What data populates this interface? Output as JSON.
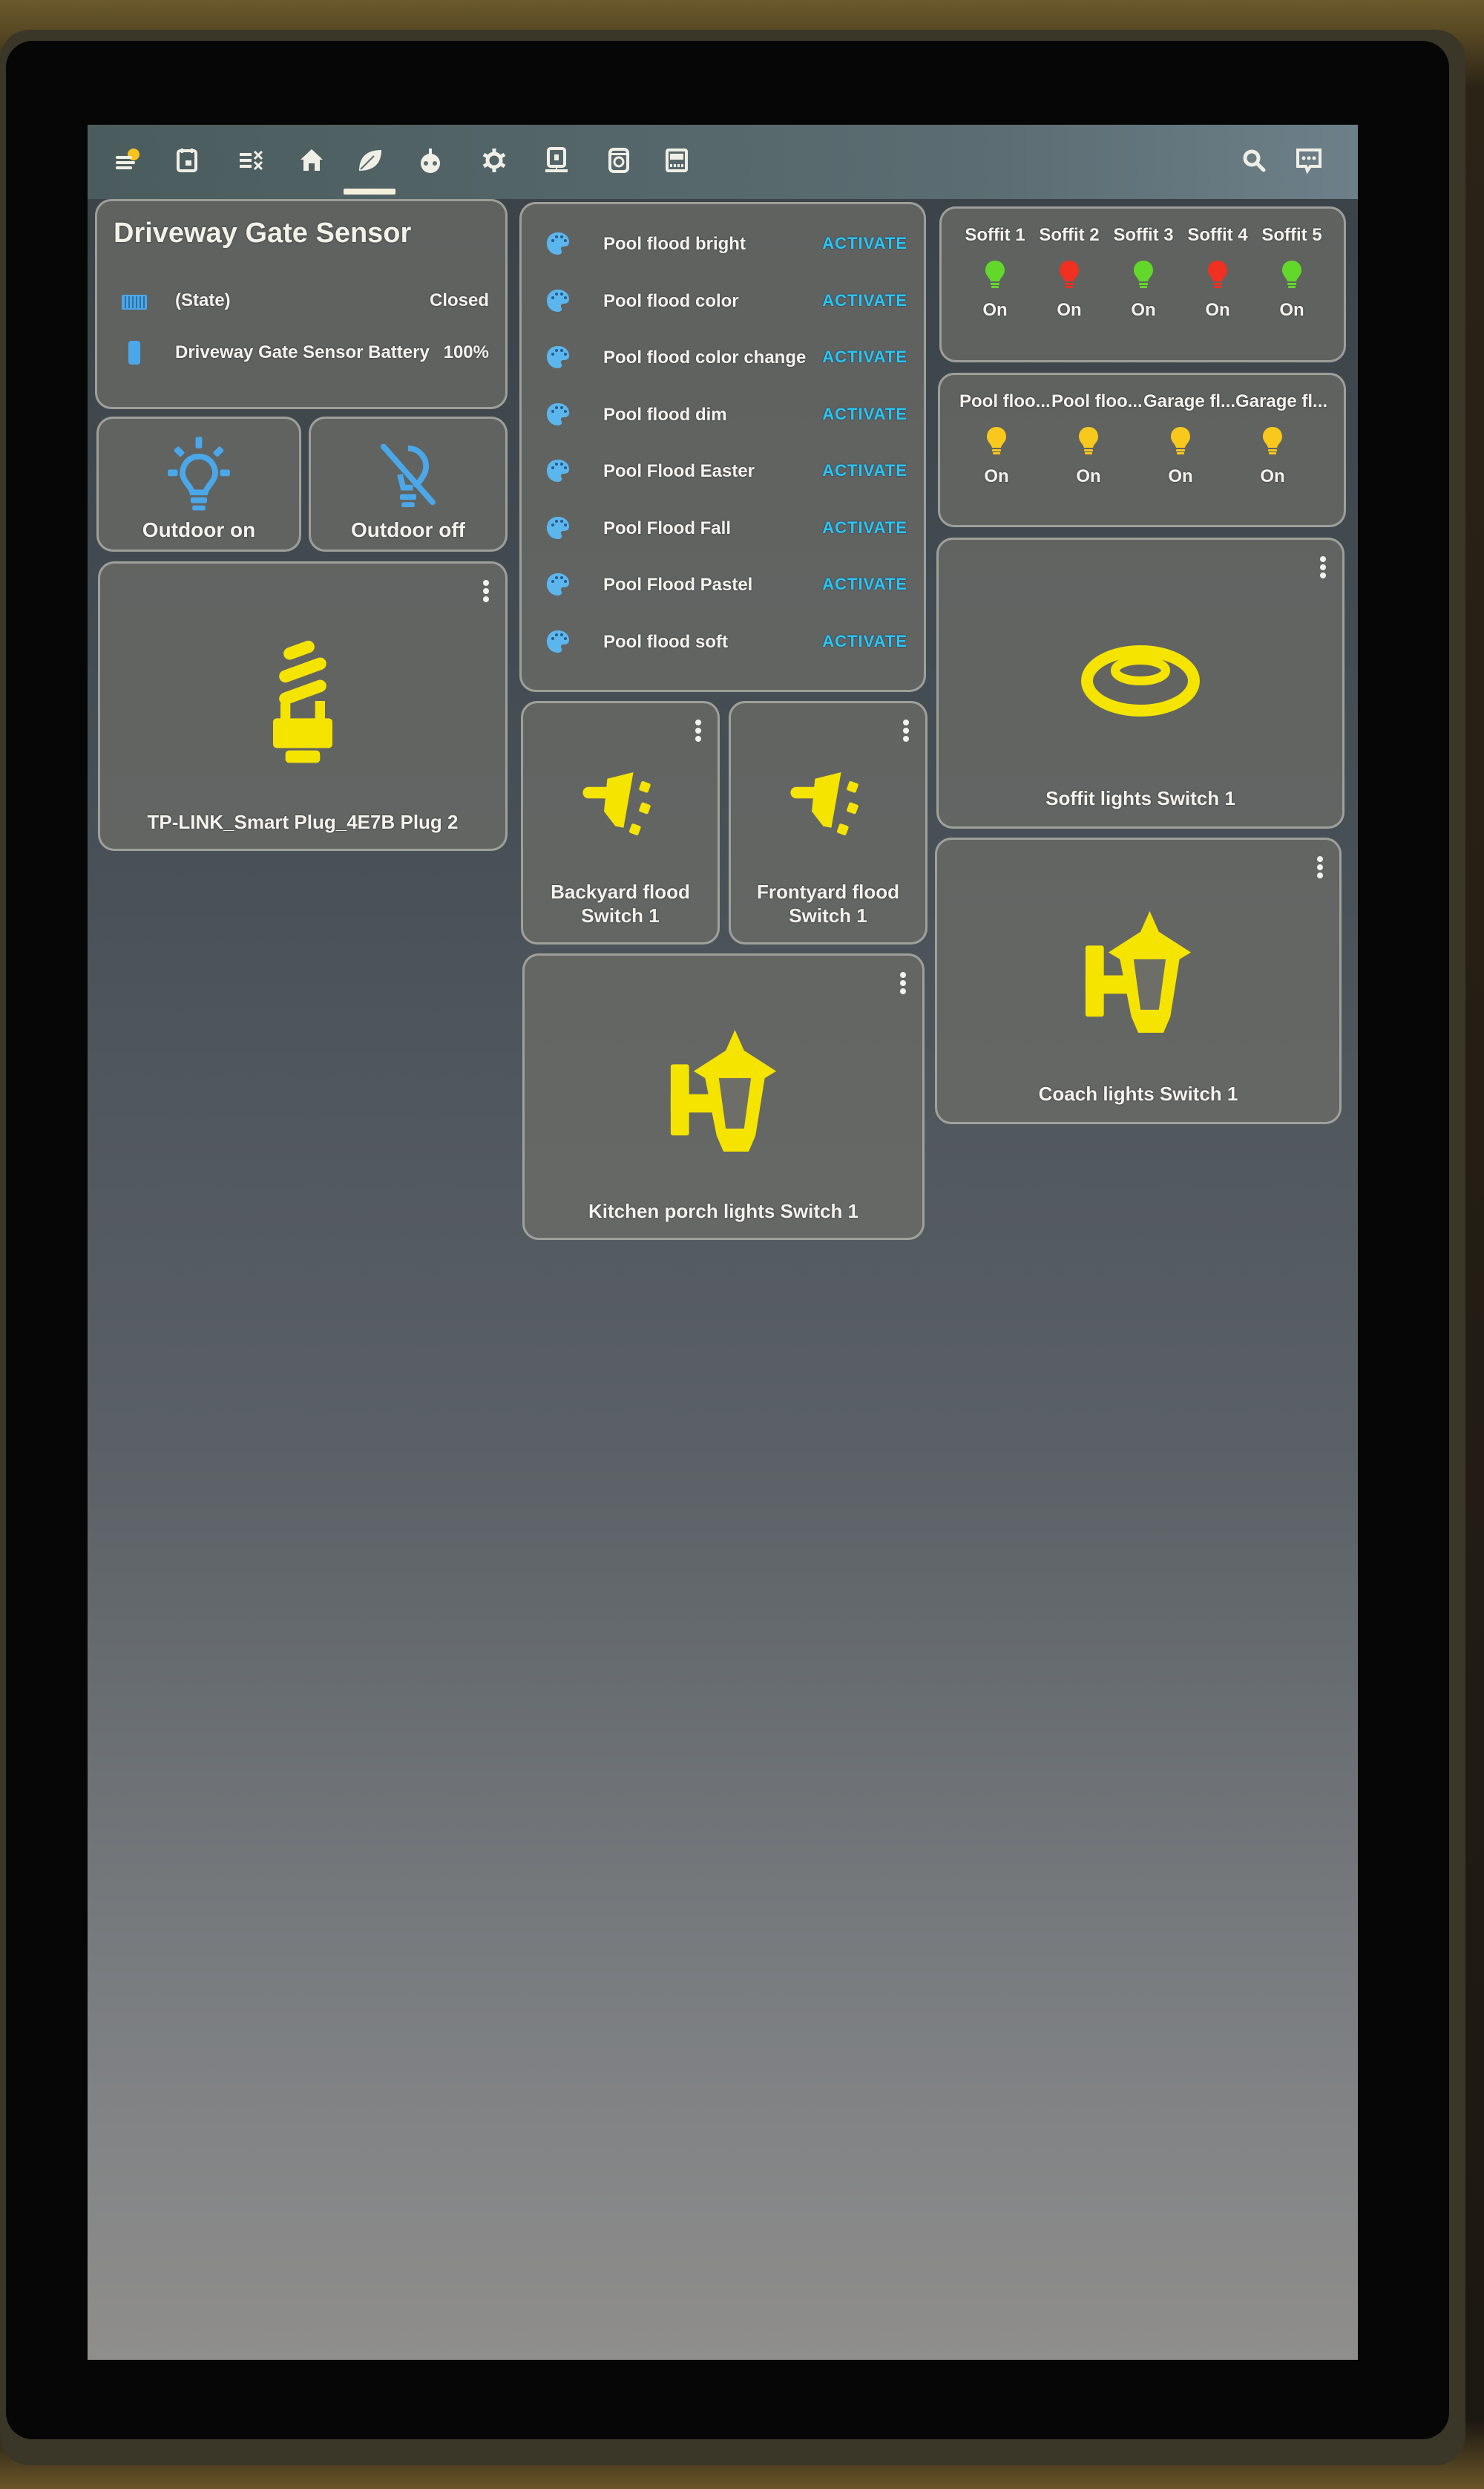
{
  "toolbar": {
    "tabs": [
      {
        "icon": "weather-partly-sunny-icon",
        "active": false
      },
      {
        "icon": "calendar-icon",
        "active": false
      },
      {
        "icon": "checklist-icon",
        "active": false
      },
      {
        "icon": "home-icon",
        "active": false
      },
      {
        "icon": "leaf-icon",
        "active": true
      },
      {
        "icon": "robot-icon",
        "active": false
      },
      {
        "icon": "gear-icon",
        "active": false
      },
      {
        "icon": "network-icon",
        "active": false
      },
      {
        "icon": "washing-machine-icon",
        "active": false
      },
      {
        "icon": "dishwasher-icon",
        "active": false
      }
    ],
    "actions": [
      {
        "icon": "search-icon"
      },
      {
        "icon": "assist-chat-icon"
      }
    ]
  },
  "gate_sensor": {
    "title": "Driveway Gate Sensor",
    "rows": [
      {
        "icon": "gate-icon",
        "label": "(State)",
        "value": "Closed"
      },
      {
        "icon": "battery-icon",
        "label": "Driveway Gate Sensor Battery",
        "value": "100%"
      }
    ]
  },
  "buttons": [
    {
      "label": "Outdoor on",
      "icon": "lightbulb-on-icon"
    },
    {
      "label": "Outdoor off",
      "icon": "lightbulb-off-icon"
    }
  ],
  "smart_plug": {
    "label": "TP-LINK_Smart Plug_4E7B Plug 2",
    "icon": "cfl-bulb-icon",
    "state": "on"
  },
  "scenes": {
    "action_label": "ACTIVATE",
    "items": [
      "Pool flood bright",
      "Pool flood color",
      "Pool flood color change",
      "Pool flood dim",
      "Pool Flood Easter",
      "Pool Flood Fall",
      "Pool Flood Pastel",
      "Pool flood soft"
    ]
  },
  "soffit_glance": {
    "items": [
      {
        "name": "Soffit 1",
        "state": "On",
        "color": "#62d92a"
      },
      {
        "name": "Soffit 2",
        "state": "On",
        "color": "#f03020"
      },
      {
        "name": "Soffit 3",
        "state": "On",
        "color": "#62d92a"
      },
      {
        "name": "Soffit 4",
        "state": "On",
        "color": "#f03020"
      },
      {
        "name": "Soffit 5",
        "state": "On",
        "color": "#62d92a"
      }
    ]
  },
  "flood_glance": {
    "items": [
      {
        "name": "Pool floo...",
        "state": "On",
        "color": "#f8c81c"
      },
      {
        "name": "Pool floo...",
        "state": "On",
        "color": "#f8c81c"
      },
      {
        "name": "Garage fl...",
        "state": "On",
        "color": "#f8c81c"
      },
      {
        "name": "Garage fl...",
        "state": "On",
        "color": "#f8c81c"
      }
    ]
  },
  "switches": {
    "backyard": {
      "label": "Backyard flood Switch 1",
      "label_lines": [
        "Backyard flood",
        "Switch 1"
      ],
      "icon": "floodlight-icon",
      "state": "on"
    },
    "frontyard": {
      "label": "Frontyard flood Switch 1",
      "label_lines": [
        "Frontyard flood",
        "Switch 1"
      ],
      "icon": "floodlight-icon",
      "state": "on"
    },
    "kitchen_porch": {
      "label": "Kitchen porch lights Switch 1",
      "icon": "outdoor-lamp-icon",
      "state": "on"
    },
    "soffit": {
      "label": "Soffit lights Switch 1",
      "icon": "ceiling-light-icon",
      "state": "on"
    },
    "coach": {
      "label": "Coach lights Switch 1",
      "icon": "outdoor-lamp-icon",
      "state": "on"
    }
  },
  "colors": {
    "active_yellow": "#f5e400",
    "accent_blue": "#4aa8ea",
    "activate_cyan": "#27c8f0"
  }
}
